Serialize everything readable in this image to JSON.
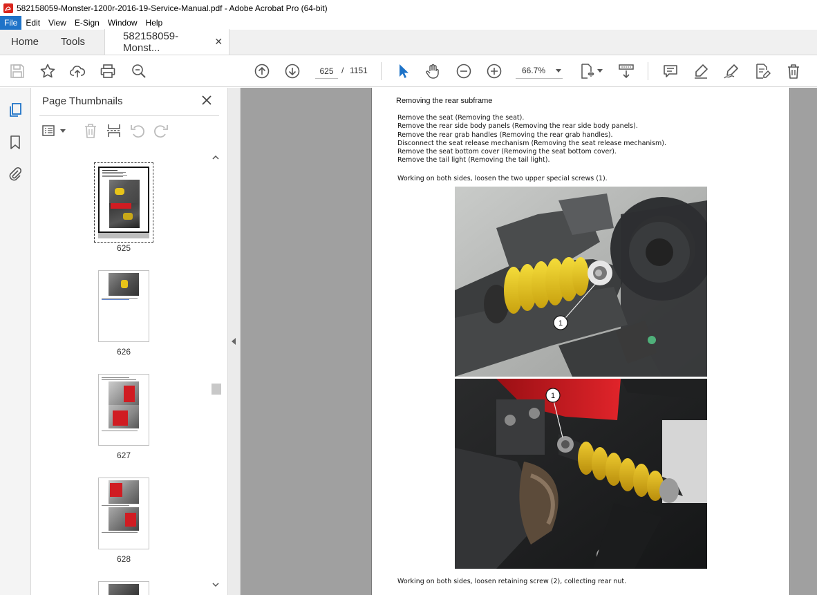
{
  "window": {
    "title": "582158059-Monster-1200r-2016-19-Service-Manual.pdf - Adobe Acrobat Pro (64-bit)"
  },
  "menu": [
    "File",
    "Edit",
    "View",
    "E-Sign",
    "Window",
    "Help"
  ],
  "tabs": {
    "home": "Home",
    "tools": "Tools",
    "document": "582158059-Monst...",
    "close_glyph": "✕"
  },
  "toolbar": {
    "current_page": "625",
    "separator": "/",
    "total_pages": "1151",
    "zoom": "66.7%"
  },
  "thumbnails": {
    "title": "Page Thumbnails",
    "pages": [
      {
        "label": "625"
      },
      {
        "label": "626"
      },
      {
        "label": "627"
      },
      {
        "label": "628"
      }
    ]
  },
  "document": {
    "heading": "Removing the rear subframe",
    "steps": [
      "Remove the seat (Removing the seat).",
      "Remove the rear side body panels (Removing the rear side body panels).",
      "Remove the rear grab handles (Removing the rear grab handles).",
      "Disconnect the seat release mechanism (Removing the seat release mechanism).",
      "Remove the seat bottom cover (Removing the seat bottom cover).",
      "Remove the tail light (Removing the tail light)."
    ],
    "note1": "Working on both sides, loosen the two upper special screws (1).",
    "note2": "Working on both sides, loosen retaining screw (2), collecting rear nut.",
    "callout1": "1",
    "callout2": "1"
  },
  "colors": {
    "accent": "#1e73c8",
    "pdf_red": "#d9251c",
    "spring_yellow": "#e8c419",
    "frame_red": "#d01c22"
  }
}
